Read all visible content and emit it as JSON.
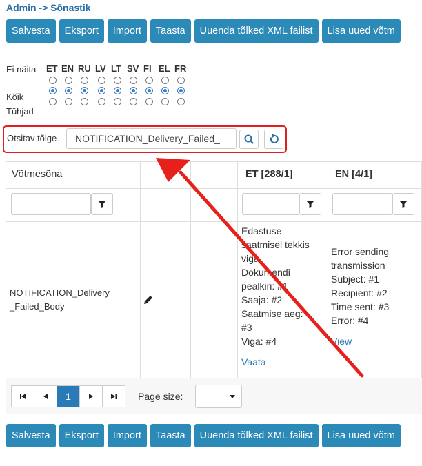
{
  "breadcrumb": "Admin -> Sõnastik",
  "toolbar": {
    "save": "Salvesta",
    "export": "Eksport",
    "import": "Import",
    "restore": "Taasta",
    "update_xml": "Uuenda tõlked XML failist",
    "add_new": "Lisa uued võtm"
  },
  "lang_filter": {
    "row_labels": [
      "Ei näita",
      "Kõik",
      "Tühjad"
    ],
    "languages": [
      "ET",
      "EN",
      "RU",
      "LV",
      "LT",
      "SV",
      "FI",
      "EL",
      "FR"
    ],
    "selected_row": "Kõik"
  },
  "search": {
    "label": "Otsitav tõlge",
    "value": "NOTIFICATION_Delivery_Failed_"
  },
  "grid": {
    "headers": {
      "key": "Võtmesõna",
      "et": "ET [288/1]",
      "en": "EN [4/1]"
    },
    "rows": [
      {
        "key": "NOTIFICATION_Delivery_Failed_Body",
        "et_lines": [
          "Edastuse",
          "saatmisel tekkis",
          "viga",
          "Dokumendi",
          "pealkiri: #1",
          "Saaja: #2",
          "Saatmise aeg:",
          "#3",
          "Viga: #4"
        ],
        "et_link": "Vaata",
        "en_lines": [
          "Error sending",
          "transmission",
          "Subject: #1",
          "Recipient: #2",
          "Time sent: #3",
          "Error: #4"
        ],
        "en_link": "View"
      }
    ]
  },
  "pager": {
    "current_page": "1",
    "page_size_label": "Page size:"
  },
  "colors": {
    "button": "#2b8ab8",
    "highlight": "#e02020",
    "link": "#2a7ab0"
  }
}
